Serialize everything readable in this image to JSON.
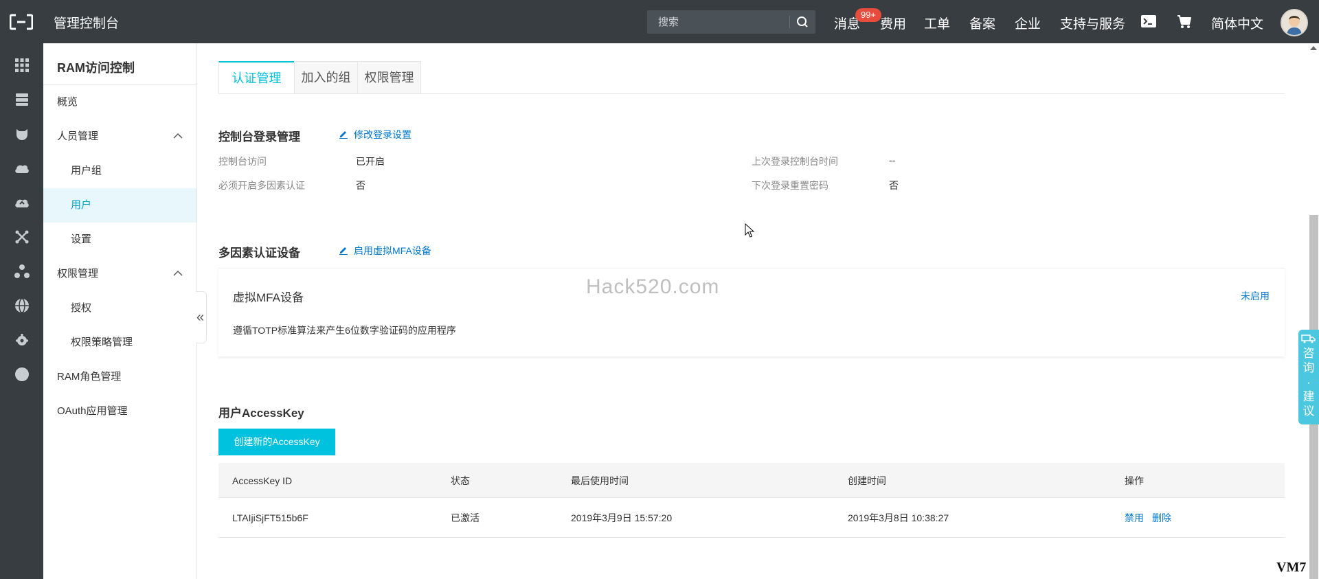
{
  "topbar": {
    "console_title": "管理控制台",
    "search_placeholder": "搜索",
    "nav": [
      "消息",
      "费用",
      "工单",
      "备案",
      "企业",
      "支持与服务",
      "简体中文"
    ],
    "message_badge": "99+"
  },
  "subnav": {
    "title": "RAM访问控制",
    "items": [
      {
        "label": "概览"
      },
      {
        "label": "人员管理"
      },
      {
        "label": "用户组"
      },
      {
        "label": "用户"
      },
      {
        "label": "设置"
      },
      {
        "label": "权限管理"
      },
      {
        "label": "授权"
      },
      {
        "label": "权限策略管理"
      },
      {
        "label": "RAM角色管理"
      },
      {
        "label": "OAuth应用管理"
      }
    ],
    "collapse_glyph": "«"
  },
  "tabs": [
    "认证管理",
    "加入的组",
    "权限管理"
  ],
  "console_login": {
    "title": "控制台登录管理",
    "edit_label": "修改登录设置",
    "rows": [
      {
        "label": "控制台访问",
        "value": "已开启"
      },
      {
        "label": "必须开启多因素认证",
        "value": "否"
      },
      {
        "label": "上次登录控制台时间",
        "value": "--"
      },
      {
        "label": "下次登录重置密码",
        "value": "否"
      }
    ]
  },
  "mfa": {
    "title": "多因素认证设备",
    "enable_label": "启用虚拟MFA设备",
    "device_name": "虚拟MFA设备",
    "device_desc": "遵循TOTP标准算法来产生6位数字验证码的应用程序",
    "device_status": "未启用"
  },
  "watermark": "Hack520.com",
  "accesskey": {
    "title": "用户AccessKey",
    "create_label": "创建新的AccessKey",
    "columns": [
      "AccessKey ID",
      "状态",
      "最后使用时间",
      "创建时间",
      "操作"
    ],
    "rows": [
      {
        "id": "LTAIjiSjFT515b6F",
        "status": "已激活",
        "last_used": "2019年3月9日 15:57:20",
        "created": "2019年3月8日 10:38:27",
        "actions": [
          "禁用",
          "删除"
        ]
      }
    ]
  },
  "feedback": {
    "line1": "咨",
    "line2": "询",
    "dot": "·",
    "line3": "建",
    "line4": "议"
  },
  "corner_text": "VM7",
  "colors": {
    "topbar": "#373d41",
    "accent": "#00c1de",
    "link": "#0077cc",
    "badge": "#e84c3d"
  },
  "rail_icons": [
    "grid-icon",
    "server-icon",
    "dog-icon",
    "cloud-icon",
    "cloud-upload-icon",
    "network-icon",
    "nodes-icon",
    "globe-icon",
    "gear-cloud-icon",
    "circle-icon"
  ]
}
